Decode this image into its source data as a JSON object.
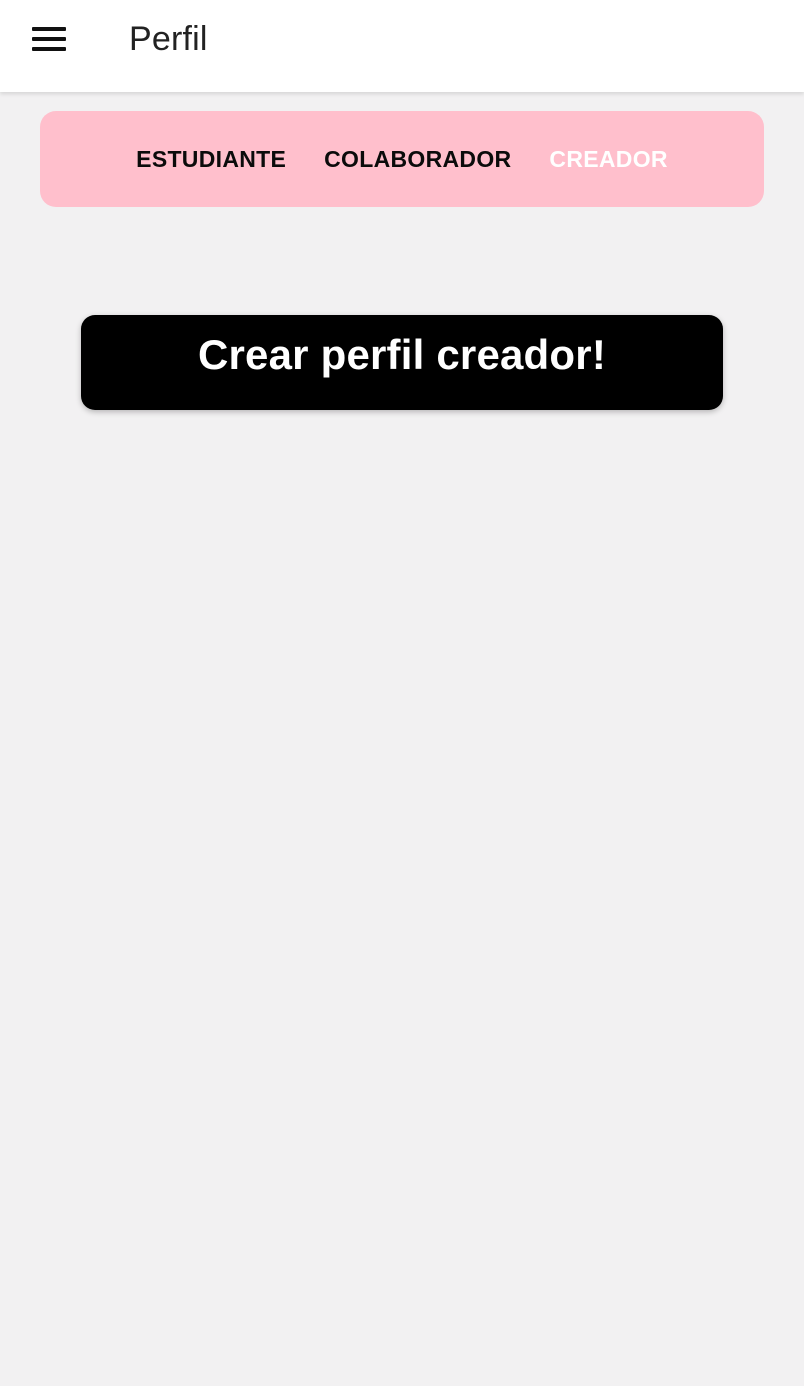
{
  "app_bar": {
    "menu_icon": "hamburger-menu-icon",
    "title": "Perfil"
  },
  "tabs": [
    {
      "label": "ESTUDIANTE",
      "active": false
    },
    {
      "label": "COLABORADOR",
      "active": false
    },
    {
      "label": "CREADOR",
      "active": true
    }
  ],
  "main": {
    "create_button_label": "Crear perfil creador!"
  },
  "colors": {
    "background": "#f2f1f2",
    "tab_bar": "#ffbfcc",
    "button": "#000000",
    "active_tab_text": "#ffffff"
  }
}
